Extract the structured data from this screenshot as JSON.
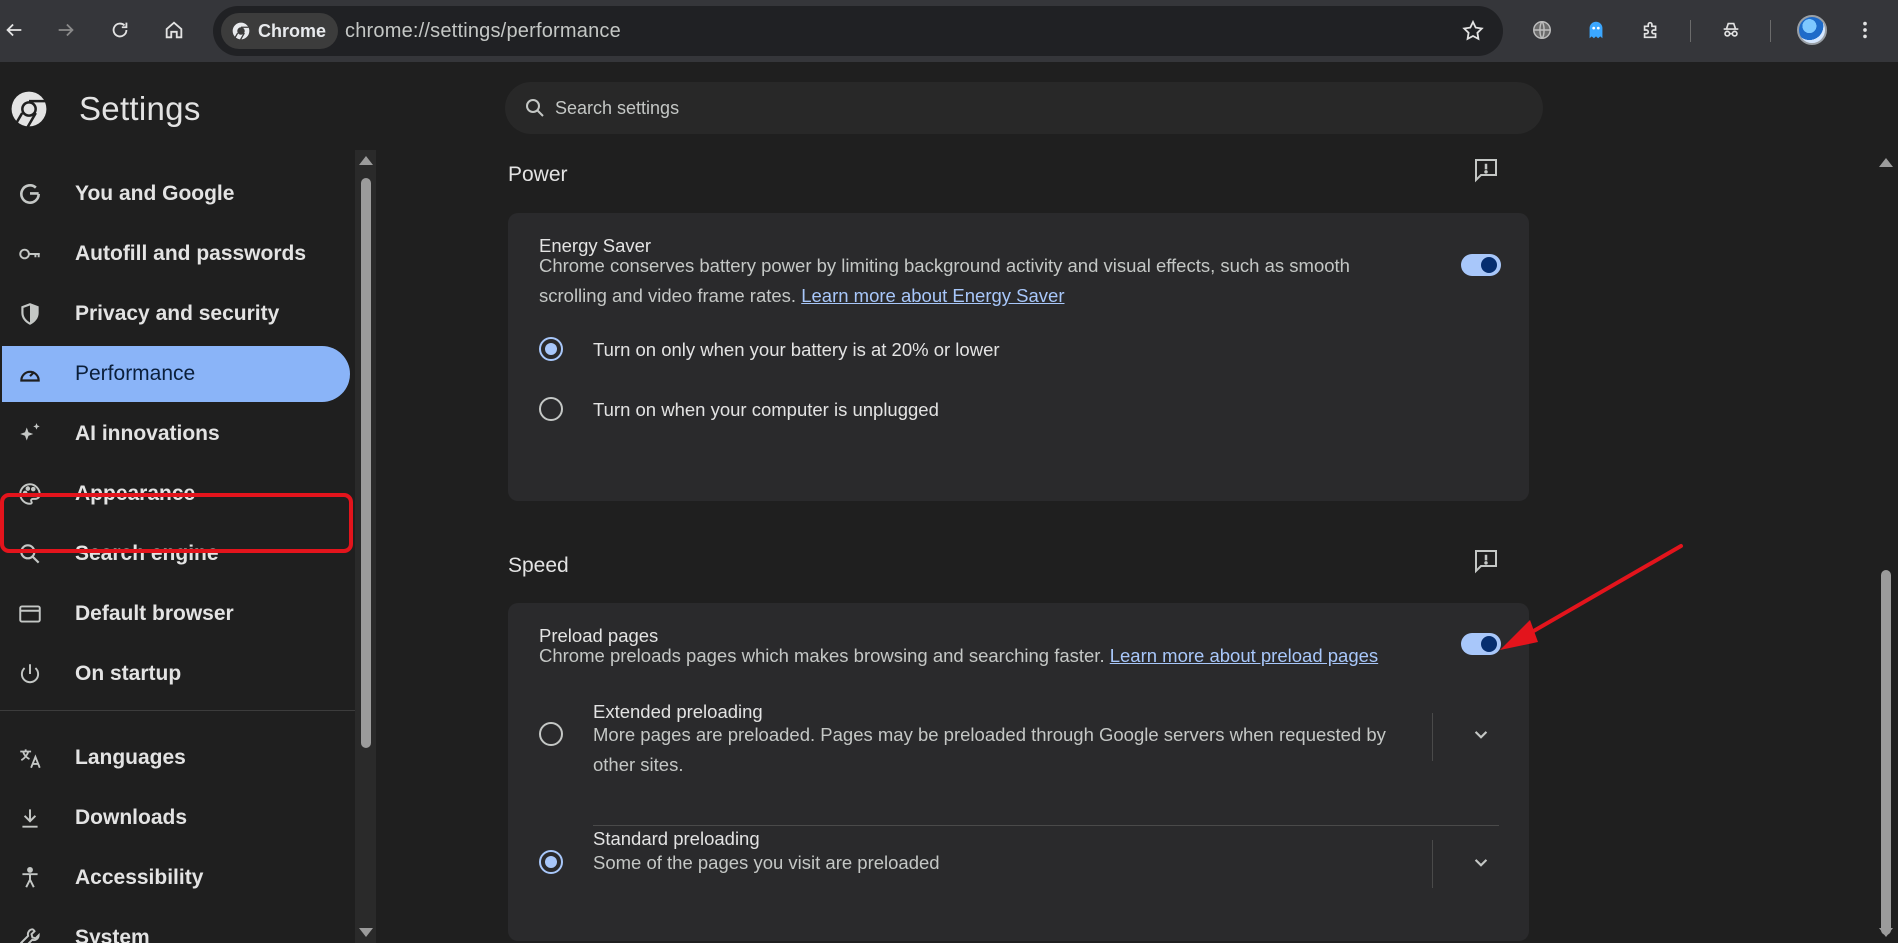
{
  "browser": {
    "chip_label": "Chrome",
    "url": "chrome://settings/performance"
  },
  "settings": {
    "title": "Settings",
    "search_placeholder": "Search settings"
  },
  "sidebar": {
    "items": [
      {
        "label": "You and Google",
        "icon": "google-g-icon"
      },
      {
        "label": "Autofill and passwords",
        "icon": "key-icon"
      },
      {
        "label": "Privacy and security",
        "icon": "shield-icon"
      },
      {
        "label": "Performance",
        "icon": "speedometer-icon",
        "active": true
      },
      {
        "label": "AI innovations",
        "icon": "sparkle-icon"
      },
      {
        "label": "Appearance",
        "icon": "palette-icon"
      },
      {
        "label": "Search engine",
        "icon": "search-icon"
      },
      {
        "label": "Default browser",
        "icon": "browser-window-icon"
      },
      {
        "label": "On startup",
        "icon": "power-icon"
      },
      {
        "label": "Languages",
        "icon": "translate-icon"
      },
      {
        "label": "Downloads",
        "icon": "download-icon"
      },
      {
        "label": "Accessibility",
        "icon": "accessibility-icon"
      },
      {
        "label": "System",
        "icon": "wrench-icon"
      }
    ]
  },
  "power": {
    "section_title": "Power",
    "energy_saver": {
      "title": "Energy Saver",
      "description": "Chrome conserves battery power by limiting background activity and visual effects, such as smooth scrolling and video frame rates.",
      "link": "Learn more about Energy Saver",
      "enabled": true
    },
    "options": [
      {
        "label": "Turn on only when your battery is at 20% or lower",
        "selected": true
      },
      {
        "label": "Turn on when your computer is unplugged",
        "selected": false
      }
    ]
  },
  "speed": {
    "section_title": "Speed",
    "preload": {
      "title": "Preload pages",
      "description": "Chrome preloads pages which makes browsing and searching faster.",
      "link": "Learn more about preload pages",
      "enabled": true
    },
    "options": [
      {
        "label": "Extended preloading",
        "description": "More pages are preloaded. Pages may be preloaded through Google servers when requested by other sites.",
        "selected": false
      },
      {
        "label": "Standard preloading",
        "description": "Some of the pages you visit are preloaded",
        "selected": true
      }
    ]
  },
  "colors": {
    "accent": "#8ab4f8",
    "link": "#a8c7fa",
    "annotation": "#e3141c"
  }
}
